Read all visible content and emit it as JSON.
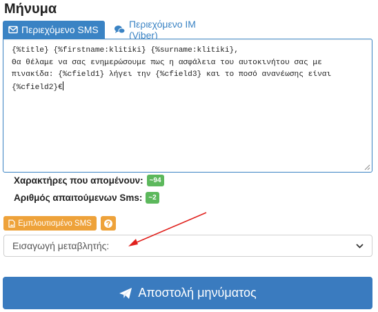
{
  "header": {
    "title": "Μήνυμα"
  },
  "tabs": [
    {
      "label": "Περιεχόμενο SMS",
      "icon": "envelope-icon",
      "active": true
    },
    {
      "label": "Περιεχόμενο IM (Viber)",
      "icon": "chat-bubbles-icon",
      "active": false
    }
  ],
  "message": {
    "text": "{%title} {%firstname:klitiki} {%surname:klitiki},\nΘα θέλαμε να σας ενημερώσουμε πως η ασφάλεια του αυτοκινήτου σας με πινακίδα: {%cfield1} λήγει την {%cfield3} και το ποσό ανανέωσης είναι {%cfield2}€"
  },
  "stats": {
    "remaining_label": "Χαρακτήρες που απομένουν:",
    "remaining_value": "~94",
    "sms_count_label": "Αριθμός απαιτούμενων Sms:",
    "sms_count_value": "~2"
  },
  "buttons": {
    "rich_sms_label": "Εμπλουτισμένο SMS",
    "rich_sms_icon": "file-image-icon",
    "help_icon": "question-circle-icon",
    "send_label": "Αποστολή μηνύματος",
    "send_icon": "paper-plane-icon"
  },
  "variable_select": {
    "selected": "Εισαγωγή μεταβλητής:"
  },
  "colors": {
    "primary": "#3a83c4",
    "send": "#3a7bbf",
    "badge": "#5cb85c",
    "warning": "#eea23a",
    "annotation": "#e0201c"
  }
}
